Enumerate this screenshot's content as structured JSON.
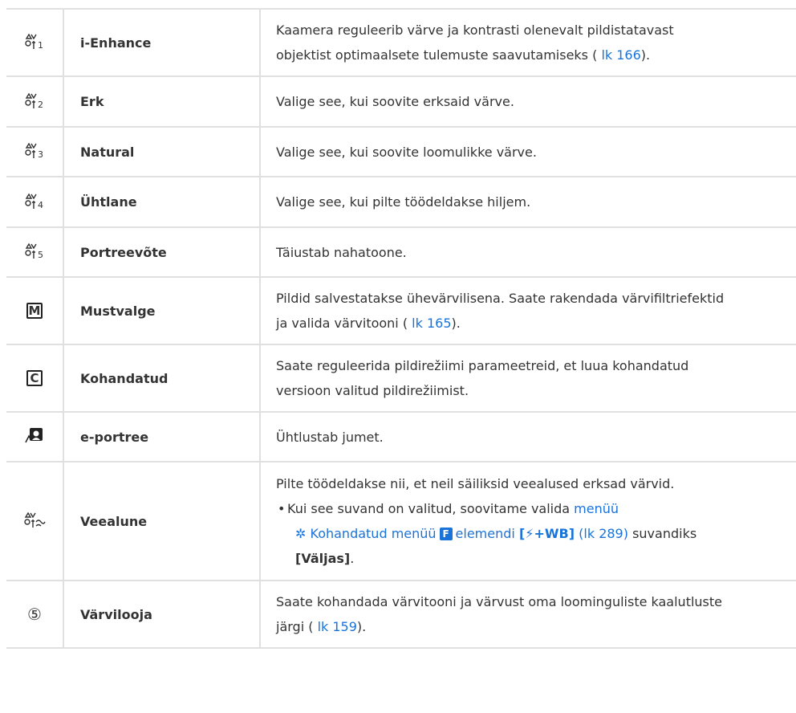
{
  "colors": {
    "link": "#1a73d9",
    "text": "#333333",
    "border": "#e0e0e0"
  },
  "rows": [
    {
      "icon": "picture-mode-1-icon",
      "name": "i-Enhance",
      "desc_line1": "Kaamera reguleerib värve ja kontrasti olenevalt pildistatavast",
      "desc_line2_pre": "objektist optimaalsete tulemuste saavutamiseks ( ",
      "desc_link": "lk 166",
      "desc_line2_post": ")."
    },
    {
      "icon": "picture-mode-2-icon",
      "name": "Erk",
      "desc": "Valige see, kui soovite erksaid värve."
    },
    {
      "icon": "picture-mode-3-icon",
      "name": "Natural",
      "desc": "Valige see, kui soovite loomulikke värve."
    },
    {
      "icon": "picture-mode-4-icon",
      "name": "Ühtlane",
      "desc": "Valige see, kui pilte töödeldakse hiljem."
    },
    {
      "icon": "picture-mode-5-icon",
      "name": "Portreevõte",
      "desc": "Täiustab nahatoone."
    },
    {
      "icon": "monochrome-icon",
      "icon_letter": "M",
      "name": "Mustvalge",
      "desc_line1": "Pildid salvestatakse ühevärvilisena. Saate rakendada värvifiltriefektid",
      "desc_line2_pre": "ja valida värvitooni ( ",
      "desc_link": "lk 165",
      "desc_line2_post": ")."
    },
    {
      "icon": "custom-icon",
      "icon_letter": "C",
      "name": "Kohandatud",
      "desc_line1": "Saate reguleerida pildirežiimi parameetreid, et luua kohandatud",
      "desc_line2": "versioon valitud pildirežiimist."
    },
    {
      "icon": "e-portrait-icon",
      "name": "e-portree",
      "desc": "Ühtlustab jumet."
    },
    {
      "icon": "underwater-icon",
      "name": "Veealune",
      "desc_line1": "Pilte töödeldakse nii, et neil säiliksid veealused erksad värvid.",
      "bullet": "•",
      "bullet_text": "Kui see suvand on valitud, soovitame valida ",
      "bullet_link": "menüü",
      "gear_icon": "✲",
      "menu_link": "Kohandatud menüü",
      "f_badge": "F",
      "elem_link": "elemendi",
      "elem_bold": "[",
      "flash_symbol": "⚡",
      "elem_bold2": "+WB]",
      "page_link": "(lk 289)",
      "after_link": " suvandiks",
      "final_bold": "[Väljas]",
      "final_post": "."
    },
    {
      "icon": "color-creator-icon",
      "icon_glyph": "⑤",
      "name": "Värvilooja",
      "desc_line1": "Saate kohandada värvitooni ja värvust oma loominguliste kaalutluste",
      "desc_line2_pre": "järgi ( ",
      "desc_link": "lk 159",
      "desc_line2_post": ")."
    }
  ]
}
